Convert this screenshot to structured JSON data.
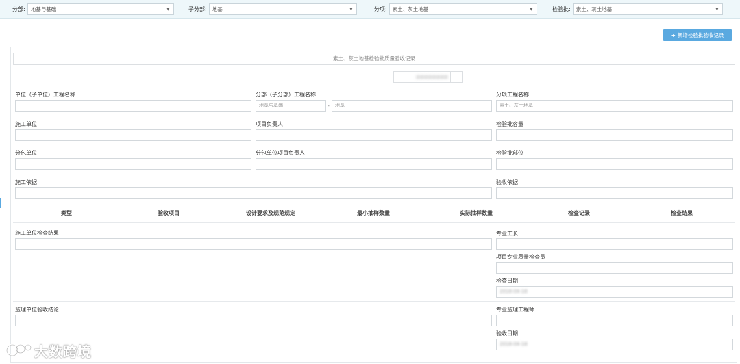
{
  "filters": {
    "division": {
      "label": "分部:",
      "value": "地基与基础"
    },
    "subdivision": {
      "label": "子分部:",
      "value": "地基"
    },
    "item": {
      "label": "分项:",
      "value": "素土、灰土地基"
    },
    "batch": {
      "label": "检验批:",
      "value": "素土、灰土地基"
    }
  },
  "add_button": {
    "label": "新增检验批验收记录"
  },
  "form": {
    "title": "素土、灰土地基检验批质量验收记录",
    "record_number": "########",
    "fields": {
      "unit_project_name": {
        "label": "单位（子单位）工程名称",
        "value": ""
      },
      "division_project_name": {
        "label": "分部（子分部）工程名称",
        "value_division": "地基与基础",
        "separator": "-",
        "value_subdivision": "地基"
      },
      "item_project_name": {
        "label": "分项工程名称",
        "value": "素土、灰土地基"
      },
      "construction_unit": {
        "label": "施工单位",
        "value": ""
      },
      "project_manager": {
        "label": "项目负责人",
        "value": ""
      },
      "batch_capacity": {
        "label": "检验批容量",
        "value": ""
      },
      "subcontract_unit": {
        "label": "分包单位",
        "value": ""
      },
      "subcontract_manager": {
        "label": "分包单位项目负责人",
        "value": ""
      },
      "batch_location": {
        "label": "检验批部位",
        "value": ""
      },
      "construction_basis": {
        "label": "施工依据",
        "value": ""
      },
      "acceptance_basis": {
        "label": "验收依据",
        "value": ""
      }
    },
    "columns": [
      "类型",
      "验收项目",
      "设计要求及规范规定",
      "最小抽样数量",
      "实际抽样数量",
      "检查记录",
      "检查结果"
    ],
    "bottom": {
      "construction_check_result": {
        "label": "施工单位检查结果",
        "value": ""
      },
      "professional_foreman": {
        "label": "专业工长",
        "value": ""
      },
      "quality_inspector": {
        "label": "项目专业质量检查员",
        "value": ""
      },
      "check_date": {
        "label": "检查日期",
        "value": "2018-04-18"
      },
      "supervision_conclusion": {
        "label": "监理单位验收结论",
        "value": ""
      },
      "supervision_engineer": {
        "label": "专业监理工程师",
        "value": ""
      },
      "acceptance_date": {
        "label": "验收日期",
        "value": "2018-04-18"
      }
    }
  },
  "watermark": {
    "text": "大数跨境"
  }
}
